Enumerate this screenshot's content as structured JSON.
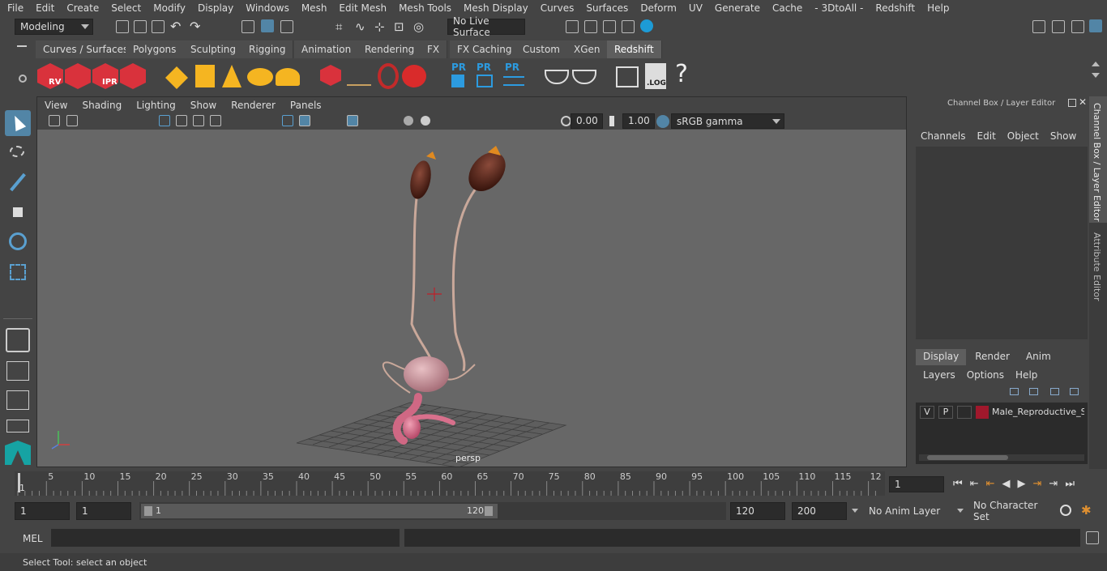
{
  "menubar": [
    "File",
    "Edit",
    "Create",
    "Select",
    "Modify",
    "Display",
    "Windows",
    "Mesh",
    "Edit Mesh",
    "Mesh Tools",
    "Mesh Display",
    "Curves",
    "Surfaces",
    "Deform",
    "UV",
    "Generate",
    "Cache",
    "- 3DtoAll -",
    "Redshift",
    "Help"
  ],
  "statusline": {
    "workspace": "Modeling",
    "live_surface": "No Live Surface"
  },
  "shelf_tabs": [
    "Curves / Surfaces",
    "Polygons",
    "Sculpting",
    "Rigging",
    "Animation",
    "Rendering",
    "FX",
    "FX Caching",
    "Custom",
    "XGen",
    "Redshift"
  ],
  "shelf_active": "Redshift",
  "shelf_labels": {
    "rv": "RV",
    "ipr": "IPR",
    "pr1": "PR",
    "pr2": "PR",
    "pr3": "PR",
    "log": ".LOG",
    "help": "?"
  },
  "viewport": {
    "menus": [
      "View",
      "Shading",
      "Lighting",
      "Show",
      "Renderer",
      "Panels"
    ],
    "exposure": "0.00",
    "gamma": "1.00",
    "color_space": "sRGB gamma",
    "camera_label": "persp"
  },
  "channel_box": {
    "title": "Channel Box / Layer Editor",
    "menus": [
      "Channels",
      "Edit",
      "Object",
      "Show"
    ],
    "tabs": [
      "Display",
      "Render",
      "Anim"
    ],
    "active_tab": "Display",
    "layer_menus": [
      "Layers",
      "Options",
      "Help"
    ],
    "layer": {
      "v": "V",
      "p": "P",
      "name": "Male_Reproductive_Sy",
      "color": "#a0182c"
    }
  },
  "sidebar_tabs": [
    "Channel Box / Layer Editor",
    "Attribute Editor"
  ],
  "timeline": {
    "ticks": [
      "5",
      "10",
      "15",
      "20",
      "25",
      "30",
      "35",
      "40",
      "45",
      "50",
      "55",
      "60",
      "65",
      "70",
      "75",
      "80",
      "85",
      "90",
      "95",
      "100",
      "105",
      "110",
      "115",
      "12"
    ],
    "start_marker": "1",
    "current_frame": "1"
  },
  "range": {
    "start": "1",
    "playback_start": "1",
    "slider_start": "1",
    "slider_end": "120",
    "playback_end": "120",
    "end": "200",
    "anim_layer": "No Anim Layer",
    "character_set": "No Character Set"
  },
  "mel": {
    "label": "MEL"
  },
  "help_line": "Select Tool: select an object"
}
